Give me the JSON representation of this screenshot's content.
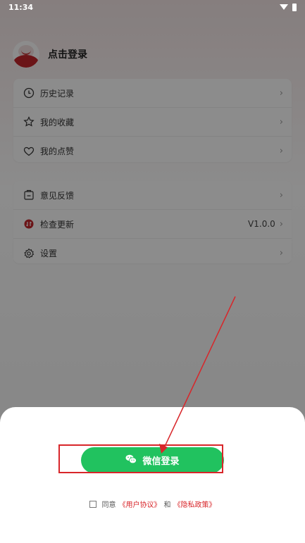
{
  "status": {
    "time": "11:34"
  },
  "header": {
    "login_text": "点击登录"
  },
  "card1": {
    "items": [
      {
        "label": "历史记录",
        "icon": "clock-icon"
      },
      {
        "label": "我的收藏",
        "icon": "star-icon"
      },
      {
        "label": "我的点赞",
        "icon": "heart-icon"
      }
    ]
  },
  "card2": {
    "items": [
      {
        "label": "意见反馈",
        "icon": "feedback-icon"
      },
      {
        "label": "检查更新",
        "icon": "update-icon",
        "value": "V1.0.0"
      },
      {
        "label": "设置",
        "icon": "gear-icon"
      }
    ]
  },
  "sheet": {
    "wechat_login_label": "微信登录",
    "agree_text": "同意",
    "user_agreement": "《用户协议》",
    "and_text": "和",
    "privacy_policy": "《隐私政策》"
  },
  "colors": {
    "wechat_green": "#21c25f",
    "accent_red": "#d8262a",
    "avatar_red": "#c4252b"
  }
}
